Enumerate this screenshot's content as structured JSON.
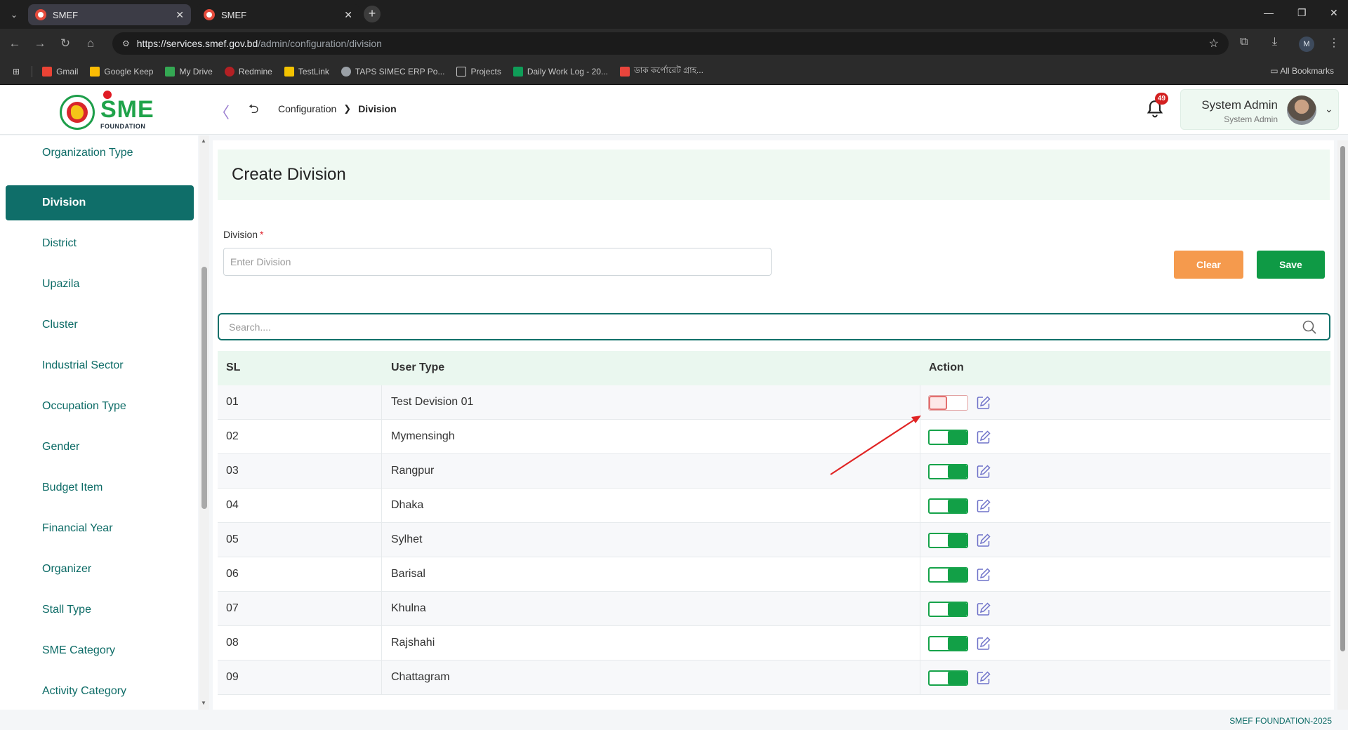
{
  "browser": {
    "tabs": [
      {
        "title": "SMEF",
        "active": true
      },
      {
        "title": "SMEF",
        "active": false
      }
    ],
    "url_host": "https://services.smef.gov.bd",
    "url_path": "/admin/configuration/division",
    "profile_initial": "M",
    "bookmarks": [
      {
        "label": "Gmail",
        "color": "#ea4335"
      },
      {
        "label": "Google Keep",
        "color": "#fbbc04"
      },
      {
        "label": "My Drive",
        "color": "#34a853"
      },
      {
        "label": "Redmine",
        "color": "#b32024"
      },
      {
        "label": "TestLink",
        "color": "#f2c200"
      },
      {
        "label": "TAPS SIMEC ERP Po...",
        "color": "#9aa0a6"
      },
      {
        "label": "Projects",
        "color": "#9aa0a6"
      },
      {
        "label": "Daily Work Log - 20...",
        "color": "#0f9d58"
      },
      {
        "label": "ডাক কর্পোরেট গ্রাহ...",
        "color": "#e8453c"
      }
    ],
    "all_bookmarks": "All Bookmarks"
  },
  "header": {
    "logo_text": "SME",
    "logo_subtext": "FOUNDATION",
    "breadcrumb_parent": "Configuration",
    "breadcrumb_current": "Division",
    "notification_count": "49",
    "user_name": "System Admin",
    "user_role": "System Admin"
  },
  "sidebar": {
    "items": [
      {
        "label": "Organization Type",
        "active": false
      },
      {
        "label": "Division",
        "active": true
      },
      {
        "label": "District",
        "active": false
      },
      {
        "label": "Upazila",
        "active": false
      },
      {
        "label": "Cluster",
        "active": false
      },
      {
        "label": "Industrial Sector",
        "active": false
      },
      {
        "label": "Occupation Type",
        "active": false
      },
      {
        "label": "Gender",
        "active": false
      },
      {
        "label": "Budget Item",
        "active": false
      },
      {
        "label": "Financial Year",
        "active": false
      },
      {
        "label": "Organizer",
        "active": false
      },
      {
        "label": "Stall Type",
        "active": false
      },
      {
        "label": "SME Category",
        "active": false
      },
      {
        "label": "Activity Category",
        "active": false
      }
    ]
  },
  "form": {
    "title": "Create Division",
    "field_label": "Division",
    "required_mark": "*",
    "placeholder": "Enter Division",
    "value": "",
    "clear_label": "Clear",
    "save_label": "Save"
  },
  "search": {
    "placeholder": "Search....",
    "value": ""
  },
  "table": {
    "headers": {
      "sl": "SL",
      "name": "User Type",
      "action": "Action"
    },
    "rows": [
      {
        "sl": "01",
        "name": "Test Devision 01",
        "active": false
      },
      {
        "sl": "02",
        "name": "Mymensingh",
        "active": true
      },
      {
        "sl": "03",
        "name": "Rangpur",
        "active": true
      },
      {
        "sl": "04",
        "name": "Dhaka",
        "active": true
      },
      {
        "sl": "05",
        "name": "Sylhet",
        "active": true
      },
      {
        "sl": "06",
        "name": "Barisal",
        "active": true
      },
      {
        "sl": "07",
        "name": "Khulna",
        "active": true
      },
      {
        "sl": "08",
        "name": "Rajshahi",
        "active": true
      },
      {
        "sl": "09",
        "name": "Chattagram",
        "active": true
      }
    ]
  },
  "footer": {
    "text": "SMEF FOUNDATION-2025"
  },
  "colors": {
    "primary": "#0f6e69",
    "save": "#0f9a45",
    "clear": "#f59a4d",
    "toggle_on": "#12a047",
    "toggle_off": "#e36f6f",
    "badge": "#d32020"
  }
}
